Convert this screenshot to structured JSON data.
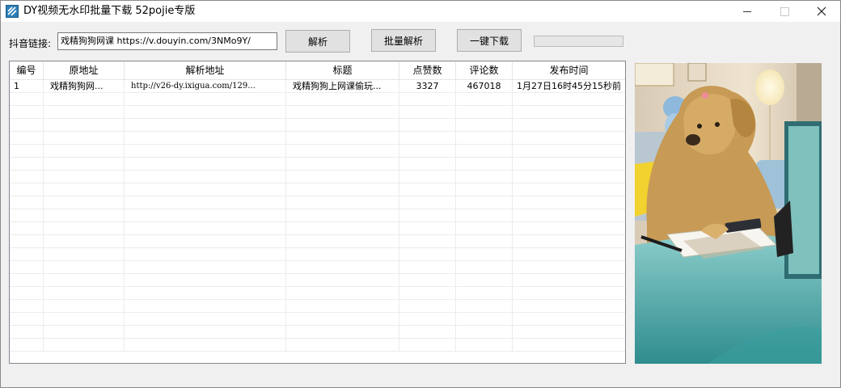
{
  "window": {
    "title": "DY视频无水印批量下载  52pojie专版",
    "icon": "app-logo-icon",
    "controls": [
      "minimize-icon",
      "maximize-icon",
      "close-icon"
    ]
  },
  "toolbar": {
    "link_label": "抖音链接:",
    "link_value": "戏精狗狗网课 https://v.douyin.com/3NMo9Y/",
    "parse_button": "解析",
    "batch_parse_button": "批量解析",
    "download_button": "一键下载",
    "progress": 0
  },
  "table": {
    "columns": [
      "编号",
      "原地址",
      "解析地址",
      "标题",
      "点赞数",
      "评论数",
      "发布时间"
    ],
    "rows": [
      [
        "1",
        "戏精狗狗网...",
        "http://v26-dy.ixigua.com/129...",
        "戏精狗狗上网课偷玩...",
        "3327",
        "467018",
        "1月27日16时45分15秒前"
      ]
    ],
    "empty_row_count": 20
  },
  "preview": {
    "image": "video-thumbnail",
    "colors": {
      "wall": "#e9dcc6",
      "dog": "#c99a52",
      "table": "#4fa9a8"
    }
  }
}
